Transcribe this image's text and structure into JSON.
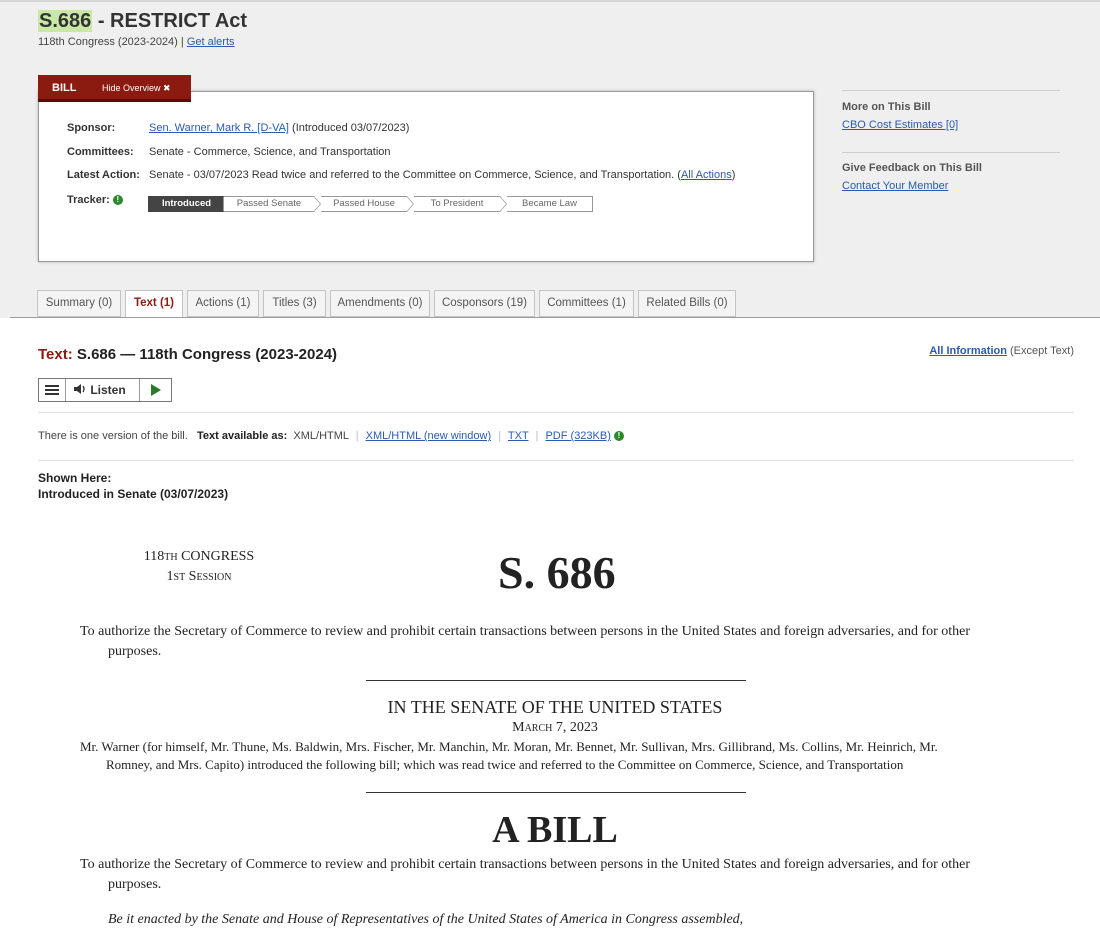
{
  "header": {
    "bill_id": "S.686",
    "title_rest": " - RESTRICT Act",
    "congress": "118th Congress (2023-2024) | ",
    "alerts_link": "Get alerts"
  },
  "overview": {
    "tab_label": "BILL",
    "hide_label": "Hide Overview ✖",
    "sponsor_label": "Sponsor:",
    "sponsor_name": "Sen. Warner, Mark R. [D-VA]",
    "sponsor_intro": " (Introduced 03/07/2023)",
    "committees_label": "Committees:",
    "committees_value": "Senate - Commerce, Science, and Transportation",
    "latest_label": "Latest Action:",
    "latest_value": "Senate - 03/07/2023 Read twice and referred to the Committee on Commerce, Science, and Transportation.  (",
    "all_actions": "All Actions",
    "latest_close": ")",
    "tracker_label": "Tracker:",
    "tracker_steps": [
      "Introduced",
      "Passed Senate",
      "Passed House",
      "To President",
      "Became Law"
    ]
  },
  "sidebar": {
    "more_heading": "More on This Bill",
    "more_link": "CBO Cost Estimates [0]",
    "feedback_heading": "Give Feedback on This Bill",
    "feedback_link": "Contact Your Member"
  },
  "tabs": [
    "Summary (0)",
    "Text (1)",
    "Actions (1)",
    "Titles (3)",
    "Amendments (0)",
    "Cosponsors (19)",
    "Committees (1)",
    "Related Bills (0)"
  ],
  "active_tab": "Text (1)",
  "text_section": {
    "heading_red": "Text:",
    "heading_rest": " S.686 — 118th Congress (2023-2024)",
    "all_info_link": "All Information",
    "all_info_rest": " (Except Text)",
    "listen_label": "Listen",
    "versions_note": "There is one version of the bill.",
    "available_as": "Text available as:",
    "format_plain": "XML/HTML",
    "format_new_window": "XML/HTML (new window)",
    "format_txt": "TXT",
    "format_pdf": "PDF (323KB)",
    "shown_here": "Shown Here:",
    "introduced_in": "Introduced in Senate (03/07/2023)"
  },
  "bill_document": {
    "congress_line": "118th CONGRESS",
    "session_line": "1st Session",
    "bill_number": "S. 686",
    "purpose_line1": "To authorize the Secretary of Commerce to review and prohibit certain transactions between persons in the United States and foreign adversaries, and for other",
    "purpose_line2": "purposes.",
    "senate_heading": "IN THE SENATE OF THE UNITED STATES",
    "date": "March 7, 2023",
    "sponsors_line1": "Mr. Warner (for himself, Mr. Thune, Ms. Baldwin, Mrs. Fischer, Mr. Manchin, Mr. Moran, Mr. Bennet, Mr. Sullivan, Mrs. Gillibrand, Ms. Collins, Mr. Heinrich, Mr.",
    "sponsors_line2": "Romney, and Mrs. Capito) introduced the following bill; which was read twice and referred to the Committee on Commerce, Science, and Transportation",
    "a_bill": "A BILL",
    "enacting_clause": "Be it enacted by the Senate and House of Representatives of the United States of America in Congress assembled,"
  }
}
